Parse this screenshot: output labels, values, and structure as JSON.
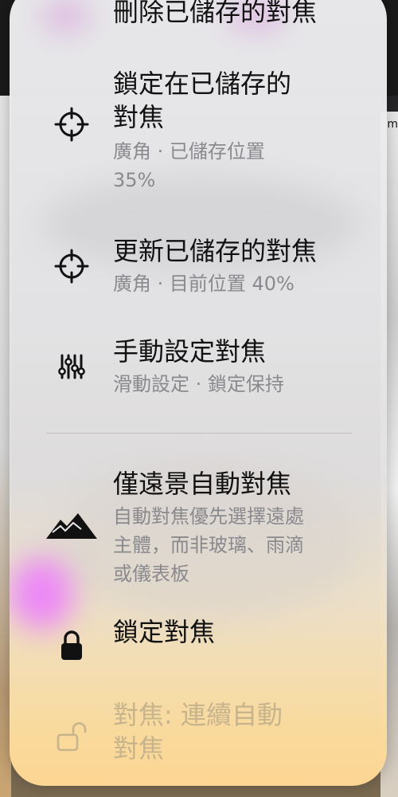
{
  "background": {
    "right_edge_text": "m"
  },
  "menu": {
    "top_partial_label": "刪除已儲存的對焦",
    "items": [
      {
        "label": "鎖定在已儲存的\n對焦",
        "detail": "廣角 · 已儲存位置\n35%",
        "icon": "crosshair-icon"
      },
      {
        "label": "更新已儲存的對焦",
        "detail": "廣角 · 目前位置 40%",
        "icon": "crosshair-icon"
      },
      {
        "label": "手動設定對焦",
        "detail": "滑動設定 · 鎖定保持",
        "icon": "sliders-icon"
      },
      {
        "label": "僅遠景自動對焦",
        "detail": "自動對焦優先選擇遠處\n主體，而非玻璃、雨滴\n或儀表板",
        "icon": "mountains-icon"
      },
      {
        "label": "鎖定對焦",
        "detail": "",
        "icon": "lock-icon"
      },
      {
        "label": "對焦: 連續自動\n對焦",
        "detail": "",
        "icon": "unlock-icon"
      }
    ]
  },
  "colors": {
    "text_primary": "#111111",
    "text_secondary": "#8a8a8e",
    "text_disabled": "#c7b38c"
  }
}
